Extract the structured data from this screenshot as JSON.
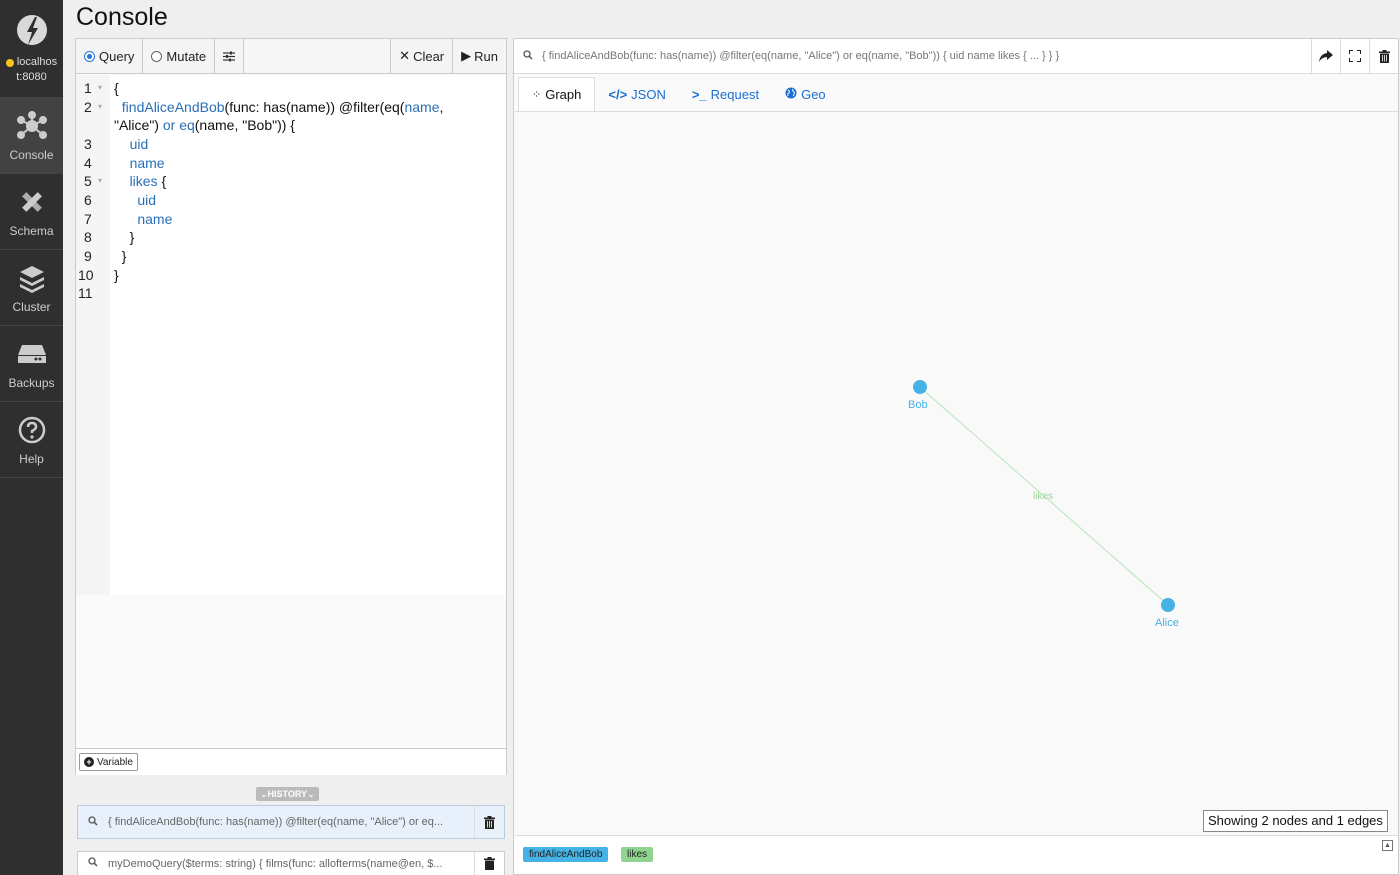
{
  "sidebar": {
    "host_line1": "localhos",
    "host_line2": "t:8080",
    "items": [
      {
        "label": "Console"
      },
      {
        "label": "Schema"
      },
      {
        "label": "Cluster"
      },
      {
        "label": "Backups"
      },
      {
        "label": "Help"
      }
    ]
  },
  "header": {
    "title": "Console"
  },
  "editor": {
    "mode_query": "Query",
    "mode_mutate": "Mutate",
    "clear_label": "Clear",
    "run_label": "Run",
    "variable_label": "Variable",
    "line_numbers": [
      "1",
      "2",
      "3",
      "4",
      "5",
      "6",
      "7",
      "8",
      "9",
      "10",
      "11"
    ],
    "code": {
      "l1": "{",
      "l2a_fn": "findAliceAndBob",
      "l2a_rest": "(func: has(name)) @filter(eq(",
      "l2a_name": "name",
      "l2a_comma": ",",
      "l2b_alice": "\"Alice\")",
      "l2b_or": "or",
      "l2b_eq": "eq",
      "l2b_rest": "(name, \"Bob\")) {",
      "l3": "uid",
      "l4": "name",
      "l5_kw": "likes",
      "l5_brace": "{",
      "l6": "uid",
      "l7": "name",
      "l8": "}",
      "l9": "}",
      "l10": "}"
    }
  },
  "history": {
    "toggle_label": "HISTORY",
    "items": [
      {
        "text": "{ findAliceAndBob(func: has(name)) @filter(eq(name, \"Alice\") or eq..."
      },
      {
        "text": "myDemoQuery($terms: string) { films(func: allofterms(name@en, $..."
      }
    ]
  },
  "result": {
    "query_text": "{ findAliceAndBob(func: has(name)) @filter(eq(name, \"Alice\") or eq(name, \"Bob\")) { uid name likes { ... } } }",
    "tabs": [
      {
        "label": "Graph",
        "icon": "graph-icon"
      },
      {
        "label": "JSON",
        "icon": "code-icon"
      },
      {
        "label": "Request",
        "icon": "terminal-icon"
      },
      {
        "label": "Geo",
        "icon": "globe-icon"
      }
    ],
    "graph": {
      "nodes": [
        {
          "label": "Bob"
        },
        {
          "label": "Alice"
        }
      ],
      "edges": [
        {
          "label": "likes"
        }
      ]
    },
    "stats": "Showing 2 nodes and 1 edges",
    "legend": [
      {
        "label": "findAliceAndBob",
        "color": "#46b3e6"
      },
      {
        "label": "likes",
        "color": "#8fd48f"
      }
    ]
  }
}
